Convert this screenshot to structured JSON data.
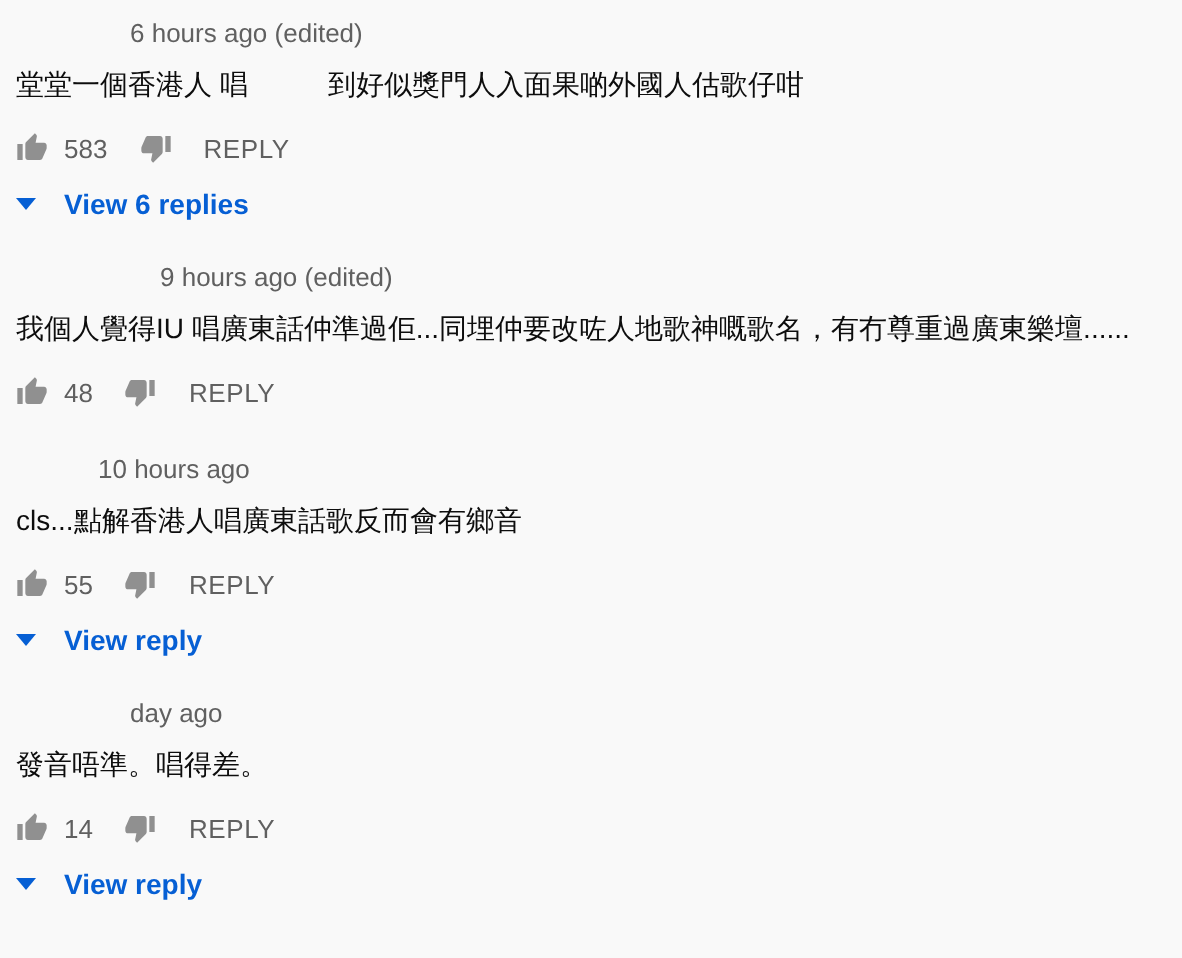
{
  "comments": [
    {
      "time": "6 hours ago (edited)",
      "text": [
        "堂堂一個香港人 唱",
        "到好似獎門人入面果啲外國人估歌仔咁"
      ],
      "likes": "583",
      "reply": "REPLY",
      "replies": "View 6 replies"
    },
    {
      "time": "9 hours ago (edited)",
      "text": [
        "我個人覺得IU 唱廣東話仲準過佢...同埋仲要改咗人地歌神嘅歌名，有冇尊重過廣東樂壇......"
      ],
      "likes": "48",
      "reply": "REPLY"
    },
    {
      "time": "10 hours ago",
      "text": [
        "cls...點解香港人唱廣東話歌反而會有鄉音"
      ],
      "likes": "55",
      "reply": "REPLY",
      "replies": "View reply"
    },
    {
      "time": "day ago",
      "text": [
        "發音唔準。唱得差。"
      ],
      "likes": "14",
      "reply": "REPLY",
      "replies": "View reply"
    }
  ]
}
